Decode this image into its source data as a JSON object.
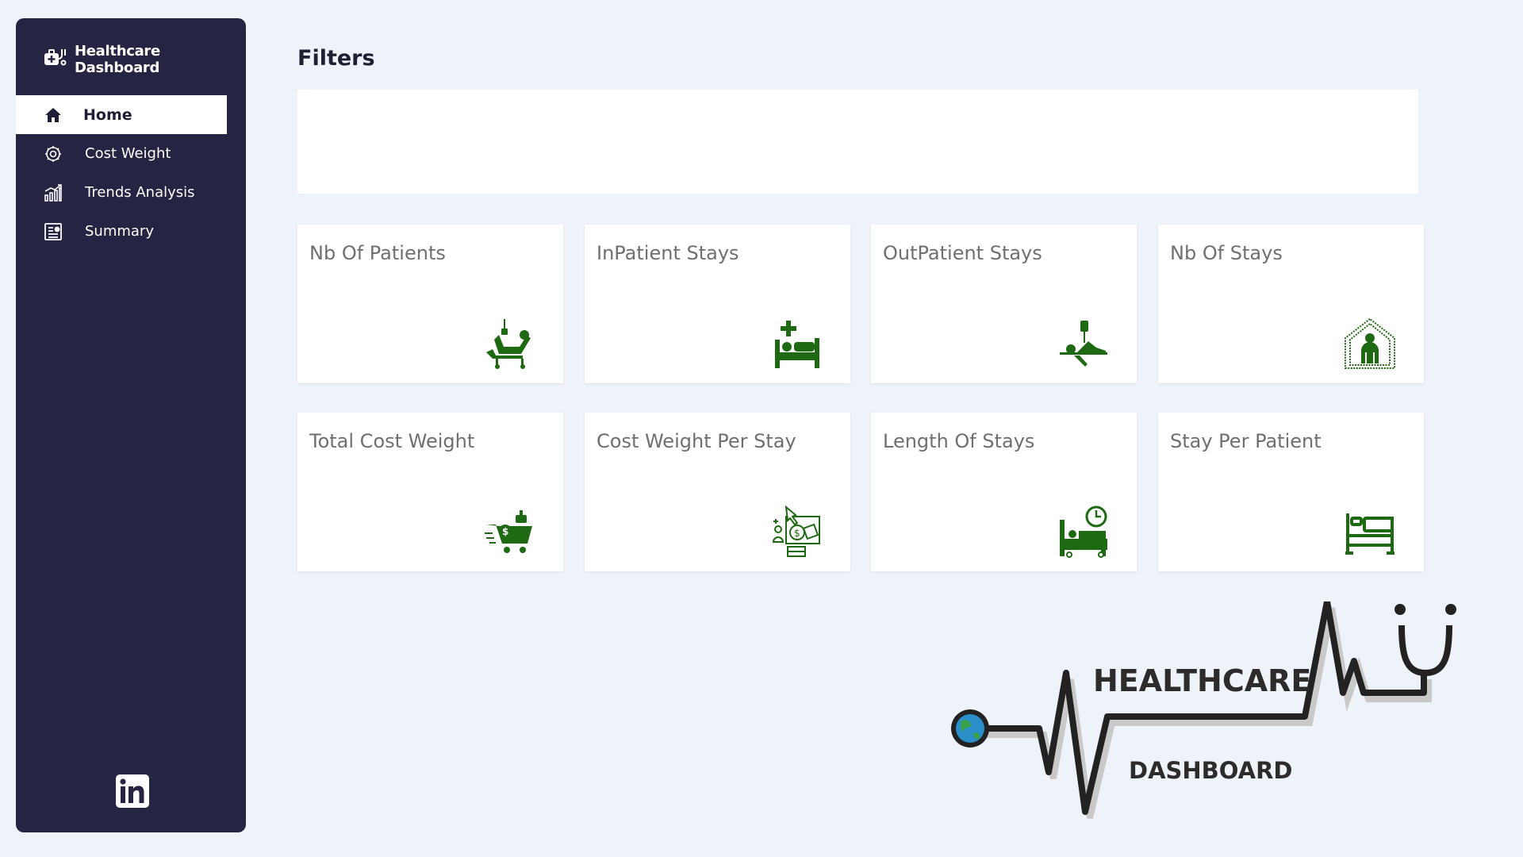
{
  "app": {
    "title": "Healthcare Dashboard"
  },
  "sidebar": {
    "items": [
      {
        "label": "Home",
        "icon": "home-icon",
        "active": true
      },
      {
        "label": "Cost Weight",
        "icon": "cost-weight-icon",
        "active": false
      },
      {
        "label": "Trends Analysis",
        "icon": "trends-icon",
        "active": false
      },
      {
        "label": "Summary",
        "icon": "summary-icon",
        "active": false
      }
    ],
    "footer_icon": "linkedin-icon"
  },
  "filters": {
    "title": "Filters"
  },
  "cards": [
    {
      "title": "Nb Of Patients",
      "icon": "patient-recliner-icon"
    },
    {
      "title": "InPatient Stays",
      "icon": "hospital-bed-icon"
    },
    {
      "title": "OutPatient Stays",
      "icon": "outpatient-iv-icon"
    },
    {
      "title": "Nb Of Stays",
      "icon": "house-person-icon"
    },
    {
      "title": "Total Cost Weight",
      "icon": "cost-cart-icon"
    },
    {
      "title": "Cost Weight Per Stay",
      "icon": "cost-per-stay-icon"
    },
    {
      "title": "Length Of Stays",
      "icon": "bed-clock-icon"
    },
    {
      "title": "Stay Per Patient",
      "icon": "bed-outline-icon"
    }
  ],
  "logo": {
    "line1": "HEALTHCARE",
    "line2": "DASHBOARD"
  },
  "colors": {
    "sidebar": "#252442",
    "background": "#eef2f9",
    "icon_green": "#1e6a12",
    "active_text": "#1e1e38"
  }
}
